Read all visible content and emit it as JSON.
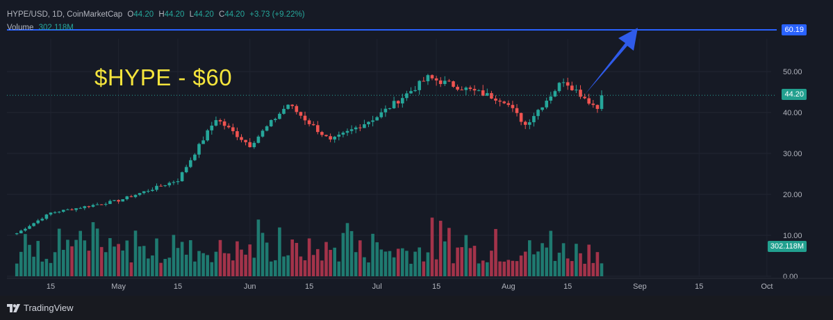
{
  "header": {
    "symbol": "HYPE/USD, 1D, CoinMarketCap",
    "open_label": "O",
    "open": "44.20",
    "high_label": "H",
    "high": "44.20",
    "low_label": "L",
    "low": "44.20",
    "close_label": "C",
    "close": "44.20",
    "change": "+3.73 (+9.22%)",
    "volume_label": "Volume",
    "volume_value": "302.118M"
  },
  "annotation": {
    "text": "$HYPE - $60"
  },
  "price_tags": {
    "target": "60.19",
    "last": "44.20",
    "volume": "302.118M"
  },
  "footer": {
    "brand": "TradingView"
  },
  "colors": {
    "up": "#26a69a",
    "down": "#ef5350",
    "up_volume": "#1f7a70",
    "down_volume": "#a3334a",
    "target_line": "#2962ff",
    "annotation": "#f4e43c",
    "background": "#161a25"
  },
  "chart_data": {
    "type": "candlestick",
    "y_axis": {
      "ticks": [
        "50.00",
        "40.00",
        "30.00",
        "20.00",
        "10.00",
        "0.00"
      ],
      "range": [
        0,
        62
      ]
    },
    "x_axis": {
      "ticks": [
        "15",
        "May",
        "15",
        "Jun",
        "15",
        "Jul",
        "15",
        "Aug",
        "15",
        "Sep",
        "15",
        "Oct"
      ]
    },
    "target_line": 60.19,
    "last_price": 44.2,
    "volume_last": "302.118M",
    "approx_close_path": [
      {
        "date": "2025-04-07",
        "close": 10.5
      },
      {
        "date": "2025-04-15",
        "close": 15.5
      },
      {
        "date": "2025-05-01",
        "close": 18.5
      },
      {
        "date": "2025-05-15",
        "close": 23.5
      },
      {
        "date": "2025-05-24",
        "close": 38.5
      },
      {
        "date": "2025-06-01",
        "close": 32.0
      },
      {
        "date": "2025-06-10",
        "close": 42.0
      },
      {
        "date": "2025-06-20",
        "close": 33.0
      },
      {
        "date": "2025-07-01",
        "close": 39.0
      },
      {
        "date": "2025-07-13",
        "close": 48.5
      },
      {
        "date": "2025-07-31",
        "close": 43.0
      },
      {
        "date": "2025-08-05",
        "close": 37.0
      },
      {
        "date": "2025-08-14",
        "close": 48.0
      },
      {
        "date": "2025-08-22",
        "close": 41.0
      },
      {
        "date": "2025-08-23",
        "close": 44.2
      }
    ]
  }
}
